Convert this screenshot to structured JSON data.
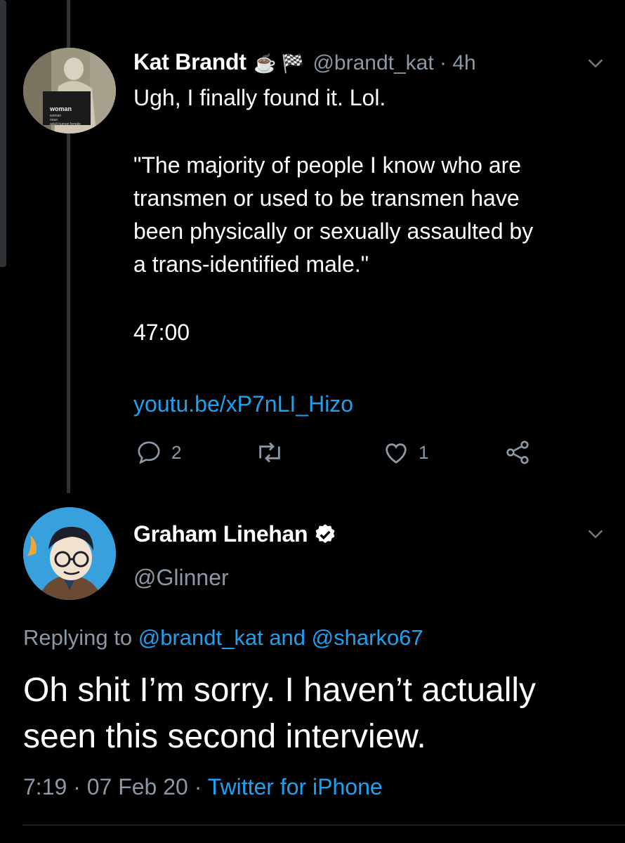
{
  "tweet1": {
    "name": "Kat Brandt",
    "emoji": "☕ 🏁",
    "handle": "@brandt_kat · 4h",
    "text_line1": "Ugh, I finally found it. Lol.",
    "quote_lines": [
      "\"The majority of people I know who are",
      "transmen or used to be transmen have",
      "been physically or sexually assaulted by",
      "a trans-identified male.\""
    ],
    "timestamp_ref": "47:00",
    "link": "youtu.be/xP7nLI_Hizo",
    "replies": "2",
    "retweets": "",
    "likes": "1",
    "avatar_caption": [
      "woman",
      "woman",
      "noun",
      "adult human female"
    ]
  },
  "tweet2": {
    "name": "Graham Linehan",
    "handle": "@Glinner",
    "replying_prefix": "Replying to",
    "replying_user1": "@brandt_kat",
    "replying_and": "and",
    "replying_user2": "@sharko67",
    "text_lines": [
      "Oh shit I’m sorry. I haven’t actually",
      "seen this second interview."
    ],
    "time": "7:19",
    "date": "07 Feb 20",
    "source": "Twitter for iPhone"
  },
  "colors": {
    "link": "#1da1f2",
    "muted": "#8b98a5",
    "background": "#000000"
  }
}
